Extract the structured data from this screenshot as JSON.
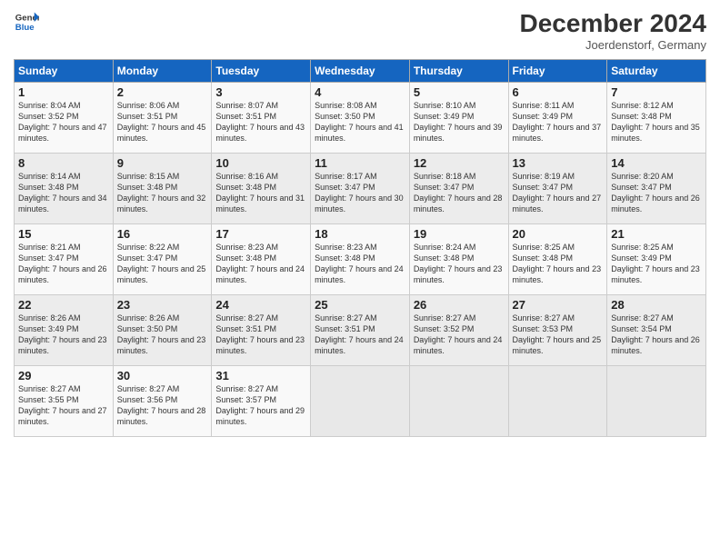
{
  "header": {
    "logo_line1": "General",
    "logo_line2": "Blue",
    "month_title": "December 2024",
    "subtitle": "Joerdenstorf, Germany"
  },
  "days_of_week": [
    "Sunday",
    "Monday",
    "Tuesday",
    "Wednesday",
    "Thursday",
    "Friday",
    "Saturday"
  ],
  "weeks": [
    [
      {
        "day": "1",
        "sunrise": "Sunrise: 8:04 AM",
        "sunset": "Sunset: 3:52 PM",
        "daylight": "Daylight: 7 hours and 47 minutes."
      },
      {
        "day": "2",
        "sunrise": "Sunrise: 8:06 AM",
        "sunset": "Sunset: 3:51 PM",
        "daylight": "Daylight: 7 hours and 45 minutes."
      },
      {
        "day": "3",
        "sunrise": "Sunrise: 8:07 AM",
        "sunset": "Sunset: 3:51 PM",
        "daylight": "Daylight: 7 hours and 43 minutes."
      },
      {
        "day": "4",
        "sunrise": "Sunrise: 8:08 AM",
        "sunset": "Sunset: 3:50 PM",
        "daylight": "Daylight: 7 hours and 41 minutes."
      },
      {
        "day": "5",
        "sunrise": "Sunrise: 8:10 AM",
        "sunset": "Sunset: 3:49 PM",
        "daylight": "Daylight: 7 hours and 39 minutes."
      },
      {
        "day": "6",
        "sunrise": "Sunrise: 8:11 AM",
        "sunset": "Sunset: 3:49 PM",
        "daylight": "Daylight: 7 hours and 37 minutes."
      },
      {
        "day": "7",
        "sunrise": "Sunrise: 8:12 AM",
        "sunset": "Sunset: 3:48 PM",
        "daylight": "Daylight: 7 hours and 35 minutes."
      }
    ],
    [
      {
        "day": "8",
        "sunrise": "Sunrise: 8:14 AM",
        "sunset": "Sunset: 3:48 PM",
        "daylight": "Daylight: 7 hours and 34 minutes."
      },
      {
        "day": "9",
        "sunrise": "Sunrise: 8:15 AM",
        "sunset": "Sunset: 3:48 PM",
        "daylight": "Daylight: 7 hours and 32 minutes."
      },
      {
        "day": "10",
        "sunrise": "Sunrise: 8:16 AM",
        "sunset": "Sunset: 3:48 PM",
        "daylight": "Daylight: 7 hours and 31 minutes."
      },
      {
        "day": "11",
        "sunrise": "Sunrise: 8:17 AM",
        "sunset": "Sunset: 3:47 PM",
        "daylight": "Daylight: 7 hours and 30 minutes."
      },
      {
        "day": "12",
        "sunrise": "Sunrise: 8:18 AM",
        "sunset": "Sunset: 3:47 PM",
        "daylight": "Daylight: 7 hours and 28 minutes."
      },
      {
        "day": "13",
        "sunrise": "Sunrise: 8:19 AM",
        "sunset": "Sunset: 3:47 PM",
        "daylight": "Daylight: 7 hours and 27 minutes."
      },
      {
        "day": "14",
        "sunrise": "Sunrise: 8:20 AM",
        "sunset": "Sunset: 3:47 PM",
        "daylight": "Daylight: 7 hours and 26 minutes."
      }
    ],
    [
      {
        "day": "15",
        "sunrise": "Sunrise: 8:21 AM",
        "sunset": "Sunset: 3:47 PM",
        "daylight": "Daylight: 7 hours and 26 minutes."
      },
      {
        "day": "16",
        "sunrise": "Sunrise: 8:22 AM",
        "sunset": "Sunset: 3:47 PM",
        "daylight": "Daylight: 7 hours and 25 minutes."
      },
      {
        "day": "17",
        "sunrise": "Sunrise: 8:23 AM",
        "sunset": "Sunset: 3:48 PM",
        "daylight": "Daylight: 7 hours and 24 minutes."
      },
      {
        "day": "18",
        "sunrise": "Sunrise: 8:23 AM",
        "sunset": "Sunset: 3:48 PM",
        "daylight": "Daylight: 7 hours and 24 minutes."
      },
      {
        "day": "19",
        "sunrise": "Sunrise: 8:24 AM",
        "sunset": "Sunset: 3:48 PM",
        "daylight": "Daylight: 7 hours and 23 minutes."
      },
      {
        "day": "20",
        "sunrise": "Sunrise: 8:25 AM",
        "sunset": "Sunset: 3:48 PM",
        "daylight": "Daylight: 7 hours and 23 minutes."
      },
      {
        "day": "21",
        "sunrise": "Sunrise: 8:25 AM",
        "sunset": "Sunset: 3:49 PM",
        "daylight": "Daylight: 7 hours and 23 minutes."
      }
    ],
    [
      {
        "day": "22",
        "sunrise": "Sunrise: 8:26 AM",
        "sunset": "Sunset: 3:49 PM",
        "daylight": "Daylight: 7 hours and 23 minutes."
      },
      {
        "day": "23",
        "sunrise": "Sunrise: 8:26 AM",
        "sunset": "Sunset: 3:50 PM",
        "daylight": "Daylight: 7 hours and 23 minutes."
      },
      {
        "day": "24",
        "sunrise": "Sunrise: 8:27 AM",
        "sunset": "Sunset: 3:51 PM",
        "daylight": "Daylight: 7 hours and 23 minutes."
      },
      {
        "day": "25",
        "sunrise": "Sunrise: 8:27 AM",
        "sunset": "Sunset: 3:51 PM",
        "daylight": "Daylight: 7 hours and 24 minutes."
      },
      {
        "day": "26",
        "sunrise": "Sunrise: 8:27 AM",
        "sunset": "Sunset: 3:52 PM",
        "daylight": "Daylight: 7 hours and 24 minutes."
      },
      {
        "day": "27",
        "sunrise": "Sunrise: 8:27 AM",
        "sunset": "Sunset: 3:53 PM",
        "daylight": "Daylight: 7 hours and 25 minutes."
      },
      {
        "day": "28",
        "sunrise": "Sunrise: 8:27 AM",
        "sunset": "Sunset: 3:54 PM",
        "daylight": "Daylight: 7 hours and 26 minutes."
      }
    ],
    [
      {
        "day": "29",
        "sunrise": "Sunrise: 8:27 AM",
        "sunset": "Sunset: 3:55 PM",
        "daylight": "Daylight: 7 hours and 27 minutes."
      },
      {
        "day": "30",
        "sunrise": "Sunrise: 8:27 AM",
        "sunset": "Sunset: 3:56 PM",
        "daylight": "Daylight: 7 hours and 28 minutes."
      },
      {
        "day": "31",
        "sunrise": "Sunrise: 8:27 AM",
        "sunset": "Sunset: 3:57 PM",
        "daylight": "Daylight: 7 hours and 29 minutes."
      },
      null,
      null,
      null,
      null
    ]
  ]
}
